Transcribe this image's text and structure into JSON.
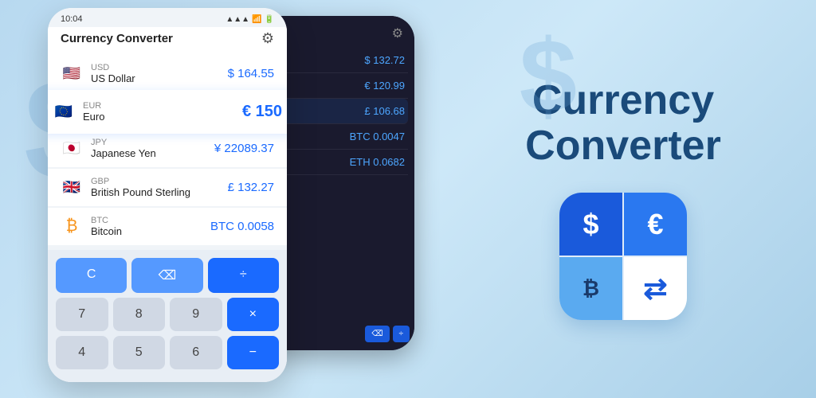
{
  "app": {
    "title_line1": "Currency",
    "title_line2": "Converter"
  },
  "phone_front": {
    "status_time": "10:04",
    "header_title": "Currency Converter",
    "currencies": [
      {
        "code": "USD",
        "name": "US Dollar",
        "amount": "$ 164.55",
        "flag": "🇺🇸",
        "selected": false
      },
      {
        "code": "EUR",
        "name": "Euro",
        "amount": "€ 150",
        "flag": "🇪🇺",
        "selected": true
      },
      {
        "code": "JPY",
        "name": "Japanese Yen",
        "amount": "¥ 22089.37",
        "flag": "🇯🇵",
        "selected": false
      },
      {
        "code": "GBP",
        "name": "British Pound Sterling",
        "amount": "£ 132.27",
        "flag": "🇬🇧",
        "selected": false
      },
      {
        "code": "BTC",
        "name": "Bitcoin",
        "amount": "BTC 0.0058",
        "flag": "₿",
        "selected": false
      }
    ],
    "calc_rows": [
      [
        "C",
        "⌫",
        "÷"
      ],
      [
        "7",
        "8",
        "9",
        "×"
      ],
      [
        "4",
        "5",
        "6",
        "−"
      ]
    ]
  },
  "phone_back": {
    "amounts": [
      "$ 132.72",
      "€ 120.99",
      "£ 106.68",
      "BTC 0.0047",
      "ETH 0.0682"
    ]
  },
  "icon": {
    "cells": [
      "$",
      "€",
      "₿",
      "⇄"
    ]
  },
  "bg_symbols": [
    "$",
    "$",
    "₿"
  ]
}
